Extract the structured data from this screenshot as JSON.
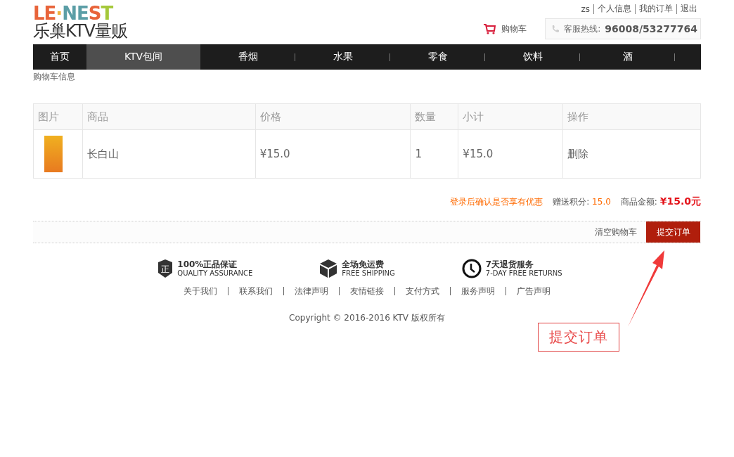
{
  "header": {
    "logo_wordmark": "LE·NEST",
    "logo_name": "乐巢KTV量贩",
    "user_links": [
      "zs",
      "个人信息",
      "我的订单",
      "退出"
    ],
    "cart_link": "购物车",
    "hotline_label": "客服热线:",
    "hotline_number": "96008/53277764"
  },
  "nav": [
    {
      "label": "首页",
      "selected": false
    },
    {
      "label": "KTV包间",
      "selected": true
    },
    {
      "label": "香烟",
      "selected": false
    },
    {
      "label": "水果",
      "selected": false
    },
    {
      "label": "零食",
      "selected": false
    },
    {
      "label": "饮料",
      "selected": false
    },
    {
      "label": "酒",
      "selected": false
    }
  ],
  "breadcrumb": "购物车信息",
  "table": {
    "columns": [
      "图片",
      "商品",
      "价格",
      "数量",
      "小计",
      "操作"
    ],
    "rows": [
      {
        "product": "长白山",
        "price": "¥15.0",
        "quantity": "1",
        "subtotal": "¥15.0",
        "action": "删除"
      }
    ]
  },
  "summary": {
    "notice": "登录后确认是否享有优惠",
    "points_label": "赠送积分:",
    "points": "15.0",
    "amount_label": "商品金额:",
    "amount": "¥15.0元"
  },
  "actions": {
    "clear": "清空购物车",
    "submit": "提交订单"
  },
  "guarantees": [
    {
      "kind": "shield",
      "title": "100%正品保证",
      "subtitle": "QUALITY ASSURANCE",
      "icon_text": "正"
    },
    {
      "kind": "box",
      "title": "全场免运费",
      "subtitle": "FREE SHIPPING"
    },
    {
      "kind": "clock",
      "title": "7天退货服务",
      "subtitle": "7-DAY FREE RETURNS"
    }
  ],
  "footer_links": [
    "关于我们",
    "联系我们",
    "法律声明",
    "友情链接",
    "支付方式",
    "服务声明",
    "广告声明"
  ],
  "copyright": "Copyright © 2016-2016 KTV 版权所有",
  "annotation": {
    "label": "提交订单"
  }
}
